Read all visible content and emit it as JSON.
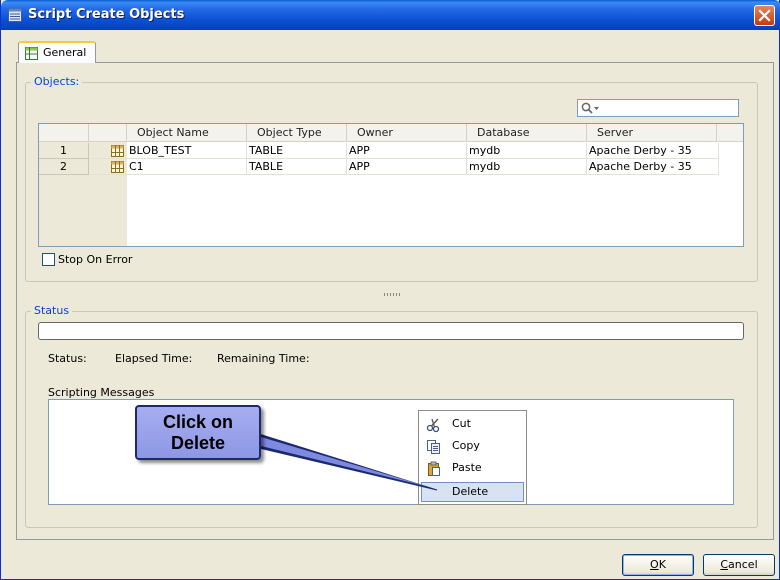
{
  "window": {
    "title": "Script Create Objects"
  },
  "tabs": [
    {
      "label": "General"
    }
  ],
  "objects": {
    "legend": "Objects:",
    "search": {
      "placeholder": ""
    },
    "columns": [
      "Object Name",
      "Object Type",
      "Owner",
      "Database",
      "Server"
    ],
    "rows": [
      {
        "num": "1",
        "name": "BLOB_TEST",
        "type": "TABLE",
        "owner": "APP",
        "database": "mydb",
        "server": "Apache Derby - 35"
      },
      {
        "num": "2",
        "name": "C1",
        "type": "TABLE",
        "owner": "APP",
        "database": "mydb",
        "server": "Apache Derby - 35"
      }
    ],
    "stop_on_error": {
      "label": "Stop On Error",
      "checked": false
    }
  },
  "status": {
    "legend": "Status",
    "progress": 0,
    "status_label": "Status:",
    "elapsed_label": "Elapsed Time:",
    "remaining_label": "Remaining Time:",
    "messages_label": "Scripting Messages"
  },
  "context_menu": {
    "items": [
      {
        "label": "Cut",
        "icon": "cut-icon"
      },
      {
        "label": "Copy",
        "icon": "copy-icon"
      },
      {
        "label": "Paste",
        "icon": "paste-icon"
      },
      {
        "label": "Delete",
        "icon": "none",
        "highlighted": true
      }
    ]
  },
  "callout": {
    "line1": "Click on",
    "line2": "Delete"
  },
  "buttons": {
    "ok_prefix": "",
    "ok_mnemonic": "O",
    "ok_suffix": "K",
    "cancel_prefix": "",
    "cancel_mnemonic": "C",
    "cancel_suffix": "ancel"
  }
}
